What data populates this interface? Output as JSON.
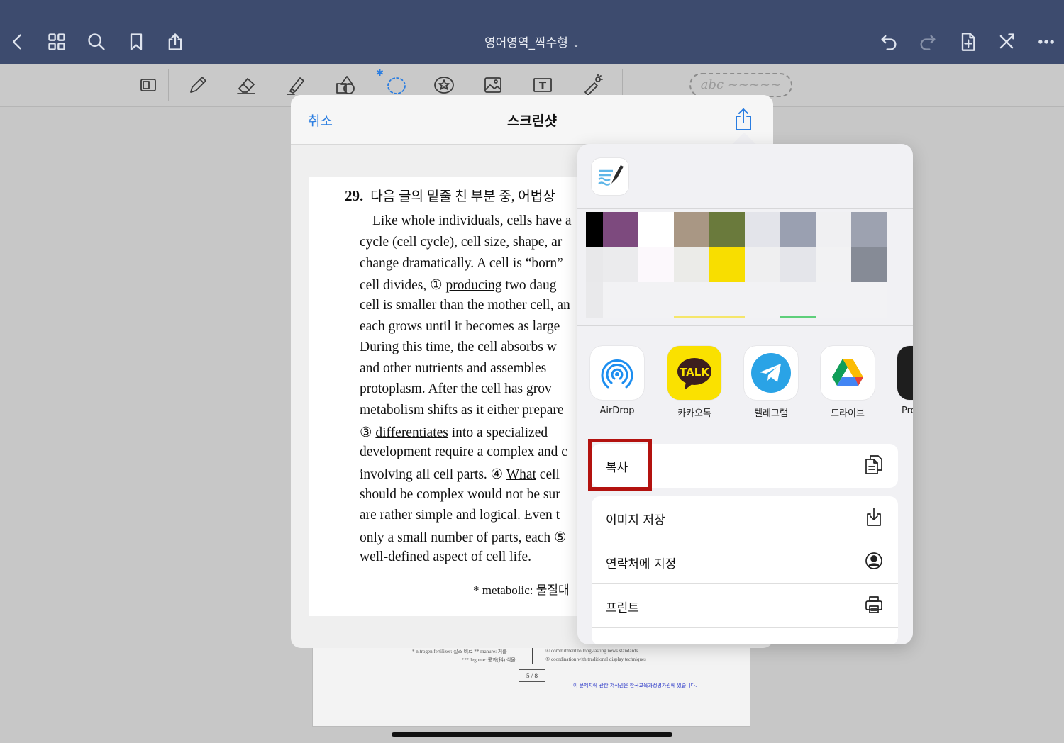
{
  "nav": {
    "document_title": "영어영역_짝수형",
    "title_chevron": "⌄"
  },
  "toolbar": {
    "lasso_marker": "✱",
    "text_tool_glyph": "T",
    "ink_preview_text": "abc ~~~~~"
  },
  "screenshot_sheet": {
    "cancel_label": "취소",
    "title": "스크린샷"
  },
  "question": {
    "number": "29.",
    "prompt": "다음 글의 밑줄 친 부분 중, 어법상",
    "lines": [
      {
        "text": "Like whole individuals, cells have a"
      },
      {
        "text": "cycle (cell cycle), cell size, shape, ar"
      },
      {
        "text": "change dramatically. A cell is “born”"
      },
      {
        "pre": "cell divides, ① ",
        "under": "producing",
        "post": " two daug"
      },
      {
        "text": "cell is smaller than the mother cell, an"
      },
      {
        "text": "each grows until it becomes as large"
      },
      {
        "text": "During this time, the cell absorbs w"
      },
      {
        "text": "and other nutrients and assembles"
      },
      {
        "text": "protoplasm. After the cell has grov"
      },
      {
        "text": "metabolism shifts as it either prepare"
      },
      {
        "pre": "③ ",
        "under": "differentiates",
        "post": " into a specialized"
      },
      {
        "text": "development require a complex and c"
      },
      {
        "pre": "involving all cell parts. ④ ",
        "under": "What",
        "post": " cell"
      },
      {
        "text": "should be complex would not be sur"
      },
      {
        "text": "are rather simple and logical. Even t"
      },
      {
        "text": "only a small number of parts, each ⑤"
      },
      {
        "text": "well-defined aspect of cell life."
      }
    ],
    "footnote": "* metabolic: 물질대"
  },
  "background_page": {
    "note_1": "* nitrogen fertilizer: 질소 비료   ** manure: 거름",
    "note_2": "*** legume: 콩과(科) 식물",
    "choice_4": "④ commitment to long-lasting news standards",
    "choice_5": "⑤ coordination with traditional display techniques",
    "page_marker": "5 / 8",
    "copyright": "이 문제지에 관한 저작권은 한국교육과정평가원에 있습니다."
  },
  "share_sheet": {
    "apps": [
      {
        "label": "AirDrop",
        "icon": "airdrop-icon"
      },
      {
        "label": "카카오톡",
        "icon": "kakaotalk-icon",
        "tile_text": "TALK"
      },
      {
        "label": "텔레그램",
        "icon": "telegram-icon"
      },
      {
        "label": "드라이브",
        "icon": "google-drive-icon"
      },
      {
        "label": "Pro",
        "icon": "procreate-icon"
      }
    ],
    "actions": [
      {
        "label": "복사",
        "icon": "copy-icon"
      },
      {
        "label": "이미지 저장",
        "icon": "save-image-icon"
      },
      {
        "label": "연락처에 지정",
        "icon": "contact-icon"
      },
      {
        "label": "프린트",
        "icon": "printer-icon"
      }
    ]
  },
  "colors": {
    "nav_bar": "#3d4b6e",
    "accent_blue": "#2a7de1",
    "highlight_red": "#b3120f",
    "kakao_yellow": "#fae100"
  }
}
